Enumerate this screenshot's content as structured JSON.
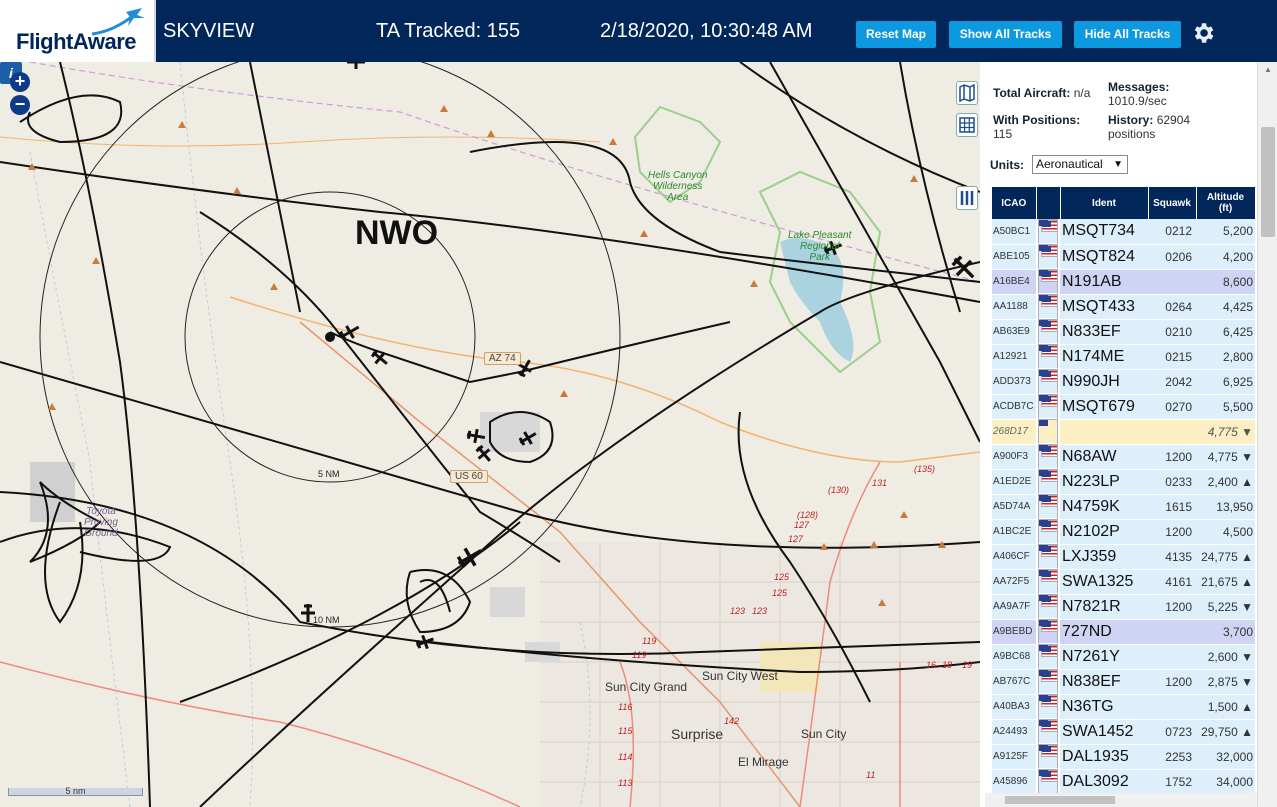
{
  "header": {
    "logo_text": "FlightAware",
    "site_name": "SKYVIEW",
    "tracked": "TA Tracked: 155",
    "clock": "2/18/2020, 10:30:48 AM",
    "buttons": {
      "reset": "Reset Map",
      "show": "Show All Tracks",
      "hide": "Hide All Tracks"
    }
  },
  "map": {
    "zoom_in": "+",
    "zoom_out": "−",
    "airport_label": "NWO",
    "ring_inner": "5 NM",
    "ring_outer": "10 NM",
    "scale": "5 nm",
    "info": "i",
    "parks": {
      "hells_canyon": "Hells Canyon\nWilderness\nArea",
      "lake_pleasant": "Lake Pleasant\nRegional\nPark",
      "proving": "Toyota\nProving\nGround"
    },
    "roads": {
      "az74": "AZ 74",
      "us60": "US 60"
    },
    "cities": {
      "sun_city_grand": "Sun City Grand",
      "sun_city_west": "Sun City West",
      "surprise": "Surprise",
      "sun_city": "Sun City",
      "el_mirage": "El Mirage"
    },
    "route_nums": [
      "(135)",
      "(130)",
      "131",
      "(128)",
      "127",
      "127",
      "125",
      "125",
      "123",
      "123",
      "119",
      "119",
      "116",
      "115",
      "114",
      "113",
      "142",
      "16",
      "18",
      "19",
      "11"
    ]
  },
  "stats": {
    "total_label": "Total Aircraft:",
    "total_value": "n/a",
    "messages_label": "Messages:",
    "messages_value": "1010.9/sec",
    "positions_label": "With Positions:",
    "positions_value": "115",
    "history_label": "History:",
    "history_value": "62904",
    "history_unit": "positions",
    "units_label": "Units:",
    "units_value": "Aeronautical"
  },
  "table": {
    "headers": {
      "icao": "ICAO",
      "ident": "Ident",
      "squawk": "Squawk",
      "altitude": "Altitude\n(ft)"
    },
    "rows": [
      {
        "icao": "A50BC1",
        "ident": "MSQT734",
        "squawk": "0212",
        "alt": "5,200",
        "flag": true,
        "style": "row"
      },
      {
        "icao": "ABE105",
        "ident": "MSQT824",
        "squawk": "0206",
        "alt": "4,200",
        "flag": true,
        "style": "row"
      },
      {
        "icao": "A16BE4",
        "ident": "N191AB",
        "squawk": "",
        "alt": "8,600",
        "flag": true,
        "style": "sel"
      },
      {
        "icao": "AA1188",
        "ident": "MSQT433",
        "squawk": "0264",
        "alt": "4,425",
        "flag": true,
        "style": "row"
      },
      {
        "icao": "AB63E9",
        "ident": "N833EF",
        "squawk": "0210",
        "alt": "6,425",
        "flag": true,
        "style": "row"
      },
      {
        "icao": "A12921",
        "ident": "N174ME",
        "squawk": "0215",
        "alt": "2,800",
        "flag": true,
        "style": "row"
      },
      {
        "icao": "ADD373",
        "ident": "N990JH",
        "squawk": "2042",
        "alt": "6,925",
        "flag": true,
        "style": "row"
      },
      {
        "icao": "ACDB7C",
        "ident": "MSQT679",
        "squawk": "0270",
        "alt": "5,500",
        "flag": true,
        "style": "row"
      },
      {
        "icao": "268D17",
        "ident": "",
        "squawk": "",
        "alt": "4,775 ▼",
        "flag": false,
        "style": "warn"
      },
      {
        "icao": "A900F3",
        "ident": "N68AW",
        "squawk": "1200",
        "alt": "4,775 ▼",
        "flag": true,
        "style": "row"
      },
      {
        "icao": "A1ED2E",
        "ident": "N223LP",
        "squawk": "0233",
        "alt": "2,400 ▲",
        "flag": true,
        "style": "row"
      },
      {
        "icao": "A5D74A",
        "ident": "N4759K",
        "squawk": "1615",
        "alt": "13,950",
        "flag": true,
        "style": "row"
      },
      {
        "icao": "A1BC2E",
        "ident": "N2102P",
        "squawk": "1200",
        "alt": "4,500",
        "flag": true,
        "style": "row"
      },
      {
        "icao": "A406CF",
        "ident": "LXJ359",
        "squawk": "4135",
        "alt": "24,775 ▲",
        "flag": true,
        "style": "row"
      },
      {
        "icao": "AA72F5",
        "ident": "SWA1325",
        "squawk": "4161",
        "alt": "21,675 ▲",
        "flag": true,
        "style": "row"
      },
      {
        "icao": "AA9A7F",
        "ident": "N7821R",
        "squawk": "1200",
        "alt": "5,225 ▼",
        "flag": true,
        "style": "row"
      },
      {
        "icao": "A9BEBD",
        "ident": "727ND",
        "squawk": "",
        "alt": "3,700",
        "flag": true,
        "style": "sel"
      },
      {
        "icao": "A9BC68",
        "ident": "N7261Y",
        "squawk": "",
        "alt": "2,600 ▼",
        "flag": true,
        "style": "row"
      },
      {
        "icao": "AB767C",
        "ident": "N838EF",
        "squawk": "1200",
        "alt": "2,875 ▼",
        "flag": true,
        "style": "row"
      },
      {
        "icao": "A40BA3",
        "ident": "N36TG",
        "squawk": "",
        "alt": "1,500 ▲",
        "flag": true,
        "style": "row"
      },
      {
        "icao": "A24493",
        "ident": "SWA1452",
        "squawk": "0723",
        "alt": "29,750 ▲",
        "flag": true,
        "style": "row"
      },
      {
        "icao": "A9125F",
        "ident": "DAL1935",
        "squawk": "2253",
        "alt": "32,000",
        "flag": true,
        "style": "row"
      },
      {
        "icao": "A45896",
        "ident": "DAL3092",
        "squawk": "1752",
        "alt": "34,000",
        "flag": true,
        "style": "row"
      }
    ]
  }
}
